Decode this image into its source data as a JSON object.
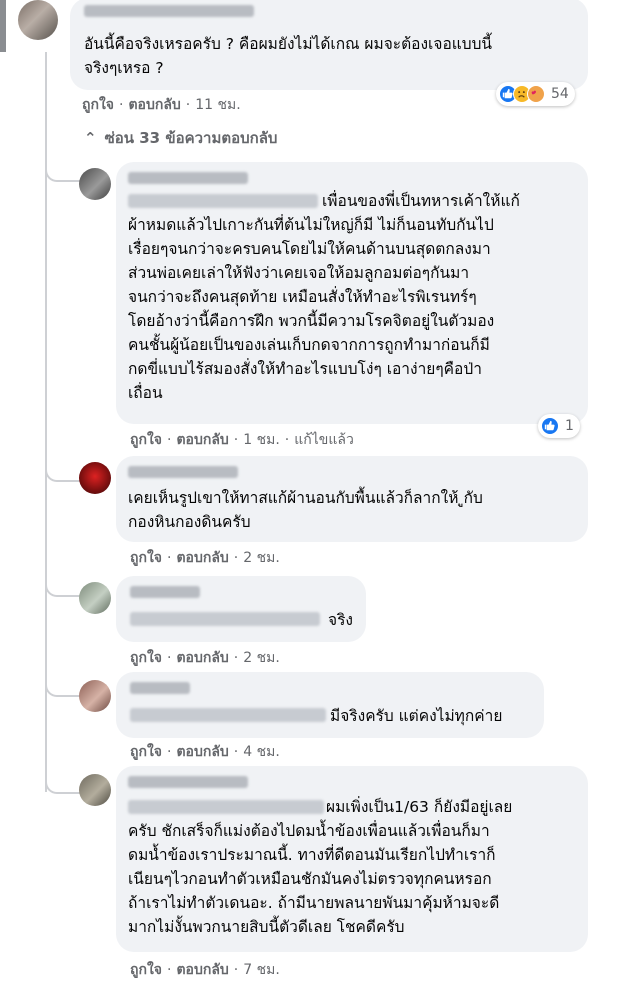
{
  "actions": {
    "like": "ถูกใจ",
    "reply": "ตอบกลับ",
    "dot": "·"
  },
  "top_comment": {
    "text": "อันนี้คือจริงเหรอครับ ? คือผมยังไม่ได้เกณ ผมจะต้องเจอแบบนี้\nจริงๆเหรอ ?",
    "time": "11 ชม.",
    "reaction_count": "54"
  },
  "hide_replies": {
    "arrow": "⌃",
    "label": "ซ่อน 33 ข้อความตอบกลับ"
  },
  "replies": [
    {
      "text": "เพื่อนของพี่เป็นทหารเค้าให้แก้\nผ้าหมดแล้วไปเกาะกันที่ต้นไม่ใหญ่ก็มี ไม่ก็นอนทับกันไป\nเรื่อยๆจนกว่าจะครบคนโดยไม่ให้คนด้านบนสุดตกลงมา\nส่วนพ่อเคยเล่าให้ฟังว่าเคยเจอให้อมลูกอมต่อๆกันมา\nจนกว่าจะถึงคนสุดท้าย เหมือนสั่งให้ทำอะไรพิเรนทร์ๆ\nโดยอ้างว่านี้คือการฝึก พวกนี้มีความโรคจิตอยู่ในตัวมอง\nคนชั้นผู้น้อยเป็นของเล่นเก็บกดจากการถูกทำมาก่อนก็มี\nกดขี่แบบไร้สมองสั่งให้ทำอะไรแบบโง่ๆ เอาง่ายๆคือป่า\nเถื่อน",
      "time": "1 ชม.",
      "edited": "แก้ไขแล้ว",
      "reaction_count": "1"
    },
    {
      "text": "เคยเห็นรูปเขาให้ทาสแก้ผ้านอนกับพื้นแล้วก็ลากให้ ูกับ\nกองหินกองดินครับ",
      "time": "2 ชม."
    },
    {
      "text": "จริง",
      "time": "2 ชม."
    },
    {
      "text": "มีจริงครับ แต่คงไม่ทุกค่าย",
      "time": "4 ชม."
    },
    {
      "text": "ผมเพิ่งเป็น1/63 ก็ยังมีอยู่เลย\nครับ ชักเสร็จก็แม่งต้องไปดมน้ำข้องเพื่อนแล้วเพื่อนก็มา\nดมน้ำข้องเราประมาณนี้. ทางที่ดีตอนมันเรียกไปทำเราก็\nเนียนๆไวกอนทำตัวเหมือนชักมันคงไม่ตรวจทุกคนหรอก\nถ้าเราไม่ทำตัวเดนอะ. ถ้ามีนายพลนายพันมาคุ้มห้ามจะดี\nมากไม่งั้นพวกนายสิบนี้ตัวดีเลย โชคดีครับ",
      "time": "7 ชม."
    }
  ],
  "colors": {
    "bubble": "#f0f2f5",
    "muted_text": "#65676b",
    "thread_line": "#ced0d4",
    "like_blue": "#1877f2",
    "haha_yellow": "#f7b928",
    "sad_orange": "#f0a24a"
  },
  "icons": [
    "like-reaction-icon",
    "sad-reaction-icon",
    "care-reaction-icon",
    "chevron-up-icon"
  ]
}
